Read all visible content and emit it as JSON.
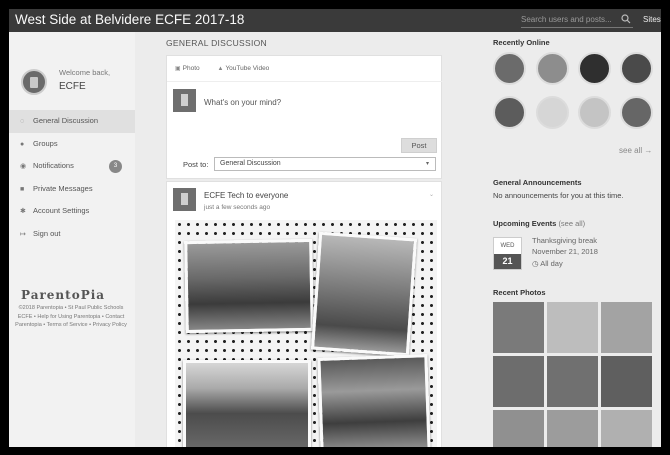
{
  "app": {
    "title": "West Side at Belvidere ECFE 2017-18",
    "search_placeholder": "Search users and posts...",
    "sites_label": "Sites"
  },
  "sidebar": {
    "welcome_text": "Welcome back,",
    "welcome_name": "ECFE",
    "items": [
      {
        "label": "General Discussion",
        "icon": "chat-icon"
      },
      {
        "label": "Groups",
        "icon": "users-icon"
      },
      {
        "label": "Notifications",
        "icon": "globe-icon",
        "badge": "3"
      },
      {
        "label": "Private Messages",
        "icon": "envelope-icon"
      },
      {
        "label": "Account Settings",
        "icon": "gear-icon"
      },
      {
        "label": "Sign out",
        "icon": "sign-out-icon"
      }
    ],
    "logo_text": "ParentoPia",
    "footer": "©2018 Parentopia • St Paul Public Schools ECFE • Help for Using Parentopia • Contact Parentopia • Terms of Service • Privacy Policy"
  },
  "main": {
    "section_title": "GENERAL DISCUSSION",
    "composer": {
      "tab_photo": "Photo",
      "tab_video": "YouTube Video",
      "prompt": "What's on your mind?",
      "post_button": "Post",
      "post_to_label": "Post to:",
      "post_to_value": "General Discussion"
    },
    "post": {
      "author": "ECFE Tech to everyone",
      "time": "just a few seconds ago"
    }
  },
  "right": {
    "recently_online_title": "Recently Online",
    "see_all": "see all →",
    "announcements_title": "General Announcements",
    "announcements_text": "No announcements for you at this time.",
    "events_title": "Upcoming Events",
    "events_see_all": "(see all)",
    "event": {
      "weekday": "WED",
      "day": "21",
      "title": "Thanksgiving break",
      "date": "November 21, 2018",
      "allday": "All day"
    },
    "recent_photos_title": "Recent Photos"
  },
  "colors": {
    "topbar": "#3a3a3a",
    "background": "#ececec",
    "card": "#ffffff",
    "accent": "#555555"
  }
}
